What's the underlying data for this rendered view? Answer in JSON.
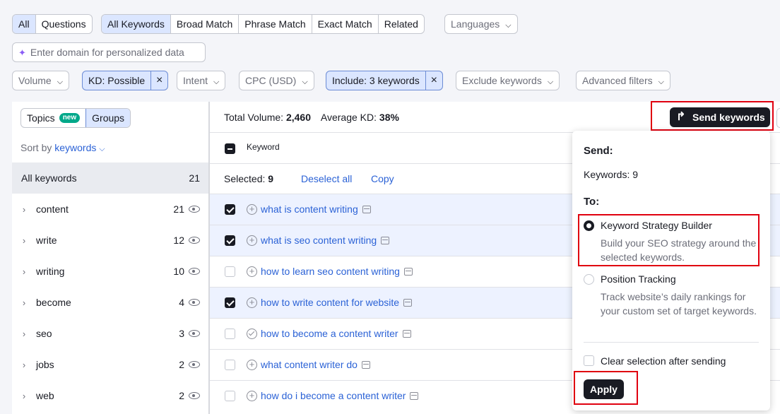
{
  "filters": {
    "tabs1": [
      "All",
      "Questions"
    ],
    "tabs1_active": 0,
    "tabs2": [
      "All Keywords",
      "Broad Match",
      "Phrase Match",
      "Exact Match",
      "Related"
    ],
    "tabs2_active": 0,
    "languages": "Languages",
    "domain_placeholder": "Enter domain for personalized data",
    "volume": "Volume",
    "kd": "KD: Possible",
    "intent": "Intent",
    "cpc": "CPC (USD)",
    "include": "Include: 3 keywords",
    "exclude": "Exclude keywords",
    "advanced": "Advanced filters"
  },
  "left": {
    "topics": "Topics",
    "new_badge": "new",
    "groups": "Groups",
    "sort_prefix": "Sort by",
    "sort_value": "keywords",
    "all_keywords": {
      "label": "All keywords",
      "count": "21"
    },
    "groups_list": [
      {
        "name": "content",
        "count": "21"
      },
      {
        "name": "write",
        "count": "12"
      },
      {
        "name": "writing",
        "count": "10"
      },
      {
        "name": "become",
        "count": "4"
      },
      {
        "name": "seo",
        "count": "3"
      },
      {
        "name": "jobs",
        "count": "2"
      },
      {
        "name": "web",
        "count": "2"
      }
    ]
  },
  "main": {
    "total_volume_label": "Total Volume:",
    "total_volume": "2,460",
    "avg_kd_label": "Average KD:",
    "avg_kd": "38%",
    "send_button": "Send keywords",
    "col_keyword": "Keyword",
    "selected_label": "Selected:",
    "selected_count": "9",
    "deselect_all": "Deselect all",
    "copy": "Copy",
    "rows": [
      {
        "keyword": "what is content writing",
        "checked": true,
        "icon": "plus"
      },
      {
        "keyword": "what is seo content writing",
        "checked": true,
        "icon": "plus"
      },
      {
        "keyword": "how to learn seo content writing",
        "checked": false,
        "icon": "plus"
      },
      {
        "keyword": "how to write content for website",
        "checked": true,
        "icon": "plus"
      },
      {
        "keyword": "how to become a content writer",
        "checked": false,
        "icon": "check"
      },
      {
        "keyword": "what content writer do",
        "checked": false,
        "icon": "plus"
      },
      {
        "keyword": "how do i become a content writer",
        "checked": false,
        "icon": "plus"
      }
    ]
  },
  "popup": {
    "send_heading": "Send:",
    "keywords_line": "Keywords: 9",
    "to_heading": "To:",
    "option1_title": "Keyword Strategy Builder",
    "option1_desc": "Build your SEO strategy around the selected keywords.",
    "option2_title": "Position Tracking",
    "option2_desc": "Track website’s daily rankings for your custom set of target keywords.",
    "clear_label": "Clear selection after sending",
    "apply": "Apply"
  },
  "colors": {
    "accent_link": "#2b62d6",
    "active_chip": "#dbe6ff",
    "highlight_box": "#e0000f",
    "dark_button": "#191b23"
  }
}
